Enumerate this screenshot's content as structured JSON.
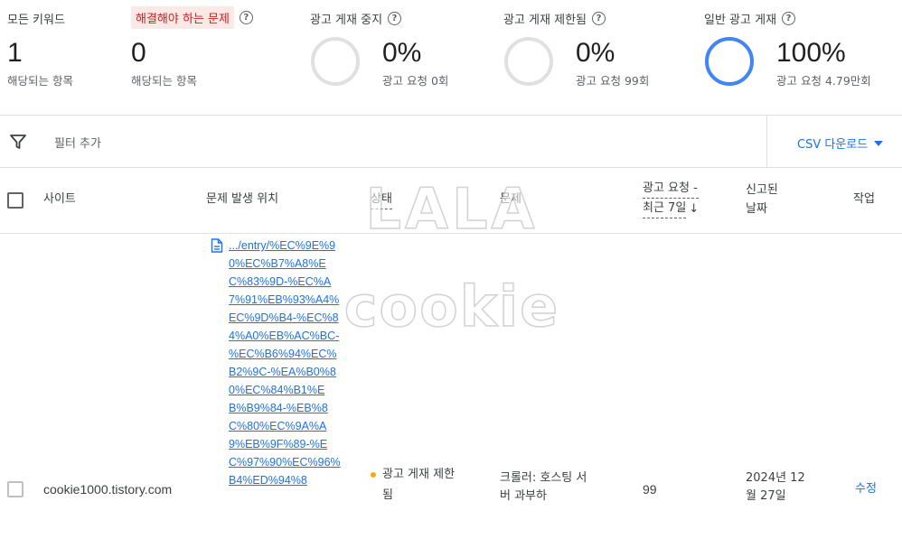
{
  "summary": {
    "all_keywords": {
      "label": "모든 키워드",
      "value": "1",
      "sub": "해당되는 항목"
    },
    "to_fix": {
      "label": "해결해야 하는 문제",
      "value": "0",
      "sub": "해당되는 항목"
    },
    "ads_stopped": {
      "label": "광고 게재 중지",
      "value": "0%",
      "sub": "광고 요청 0회",
      "percent": 0
    },
    "ads_limited": {
      "label": "광고 게재 제한됨",
      "value": "0%",
      "sub": "광고 요청 99회",
      "percent": 0
    },
    "ads_normal": {
      "label": "일반 광고 게재",
      "value": "100%",
      "sub": "광고 요청 4.79만회",
      "percent": 100
    },
    "help_glyph": "?",
    "colors": {
      "ring_track": "#e0e0e0",
      "ring_fill": "#4285f4",
      "warn_bg": "#fce8e6",
      "warn_text": "#c5221f"
    }
  },
  "filter": {
    "label": "필터 추가",
    "icon": "filter-icon"
  },
  "csv": {
    "label": "CSV 다운로드"
  },
  "table": {
    "headers": {
      "site": "사이트",
      "location": "문제 발생 위치",
      "status": "상태",
      "issue": "문제",
      "requests_line1": "광고 요청 -",
      "requests_line2": "최근 7일",
      "sort_arrow": "↓",
      "reported_line1": "신고된",
      "reported_line2": "날짜",
      "action": "작업"
    },
    "rows": [
      {
        "site": "cookie1000.tistory.com",
        "location_url": ".../entry/%EC%9E%90%EC%B7%A8%EC%83%9D-%EC%A7%91%EB%93%A4%EC%9D%B4-%EC%84%A0%EB%AC%BC-%EC%B6%94%EC%B2%9C-%EA%B0%80%EC%84%B1%EB%B9%84-%EB%8C%80%EC%9A%A9%EB%9F%89-%EC%97%90%EC%96%B4%ED%94%8",
        "status_line1": "광고 게재 제한",
        "status_line2": "됨",
        "issue_line1": "크롤러: 호스팅 서",
        "issue_line2": "버 과부하",
        "requests": "99",
        "date_line1": "2024년 12",
        "date_line2": "월 27일",
        "action": "수정"
      }
    ]
  },
  "watermark": {
    "line1": "LALA",
    "line2": "cookie"
  }
}
